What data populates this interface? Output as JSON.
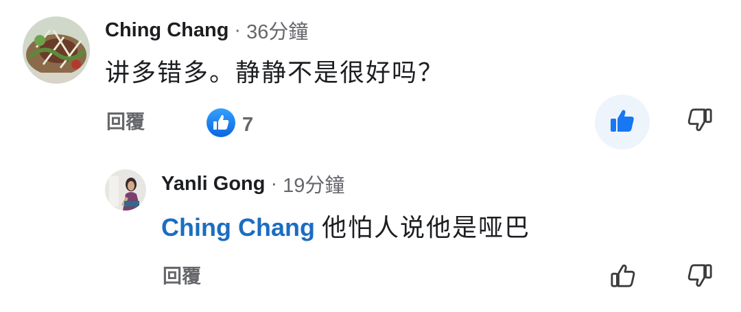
{
  "comment": {
    "author": "Ching Chang",
    "separator": "·",
    "time": "36分鐘",
    "text": "讲多错多。静静不是很好吗？",
    "reply_label": "回覆",
    "like_count": "7",
    "liked": true
  },
  "reply": {
    "author": "Yanli Gong",
    "separator": "·",
    "time": "19分鐘",
    "mention": "Ching Chang",
    "text": "他怕人说他是哑巴",
    "reply_label": "回覆"
  },
  "colors": {
    "mention": "#1b6dc1",
    "like_active": "#1877f2",
    "secondary_text": "#65676b"
  },
  "icons": {
    "reaction": "thumbs-up-reaction-icon",
    "like": "thumbs-up-icon",
    "dislike": "thumbs-down-icon"
  }
}
